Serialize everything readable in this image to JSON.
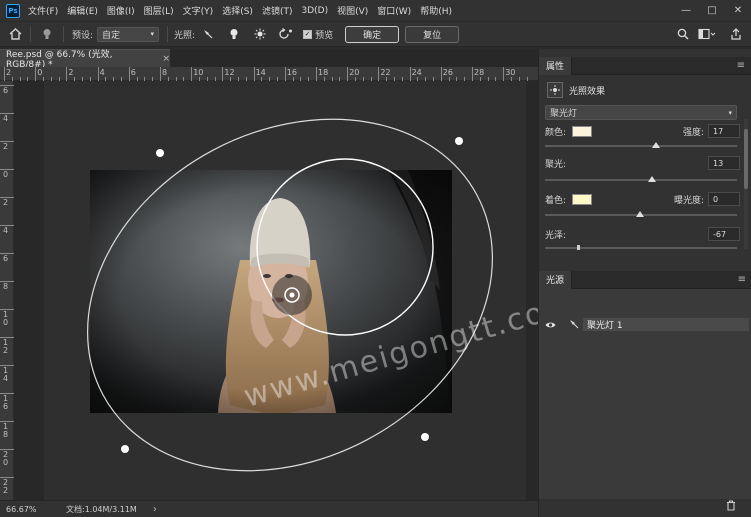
{
  "app": {
    "logo_text": "Ps",
    "menu": [
      "文件(F)",
      "编辑(E)",
      "图像(I)",
      "图层(L)",
      "文字(Y)",
      "选择(S)",
      "滤镜(T)",
      "3D(D)",
      "视图(V)",
      "窗口(W)",
      "帮助(H)"
    ],
    "window_controls": [
      "—",
      "□",
      "✕"
    ]
  },
  "options": {
    "preset_label": "预设:",
    "preset_value": "自定",
    "light_label": "光照:",
    "preview_label": "预览",
    "preview_checked": true,
    "ok_label": "确定",
    "reset_label": "复位"
  },
  "document": {
    "tab_title": "Ree.psd @ 66.7% (光效, RGB/8#) *",
    "tab_close": "×"
  },
  "rulers": {
    "h_labels": [
      "2",
      "0",
      "2",
      "4",
      "6",
      "8",
      "10",
      "12",
      "14",
      "16",
      "18",
      "20",
      "22",
      "24",
      "26",
      "28",
      "30"
    ],
    "v_labels": [
      "6",
      "4",
      "2",
      "0",
      "2",
      "4",
      "6",
      "8",
      "10",
      "12",
      "14",
      "16",
      "18",
      "20",
      "22"
    ]
  },
  "watermark": "www.meigongtt.com",
  "status": {
    "zoom": "66.67%",
    "doc_info": "文档:1.04M/3.11M",
    "arrow": "›"
  },
  "properties": {
    "tab": "属性",
    "effect_title": "光照效果",
    "light_type": "聚光灯",
    "color_label": "颜色:",
    "intensity_label": "强度:",
    "intensity_value": "17",
    "hotspot_label": "聚光:",
    "hotspot_value": "13",
    "colorize_label": "着色:",
    "exposure_label": "曝光度:",
    "exposure_value": "0",
    "gloss_label": "光泽:",
    "gloss_value": "-67",
    "color_swatch": "#fbf3dc",
    "colorize_swatch": "#fff8c8"
  },
  "lights_panel": {
    "tab": "光源",
    "layer_name": "聚光灯 1"
  },
  "colors": {
    "accent_ps": "#31a8ff",
    "ellipse_stroke": "#e8e8e8"
  }
}
